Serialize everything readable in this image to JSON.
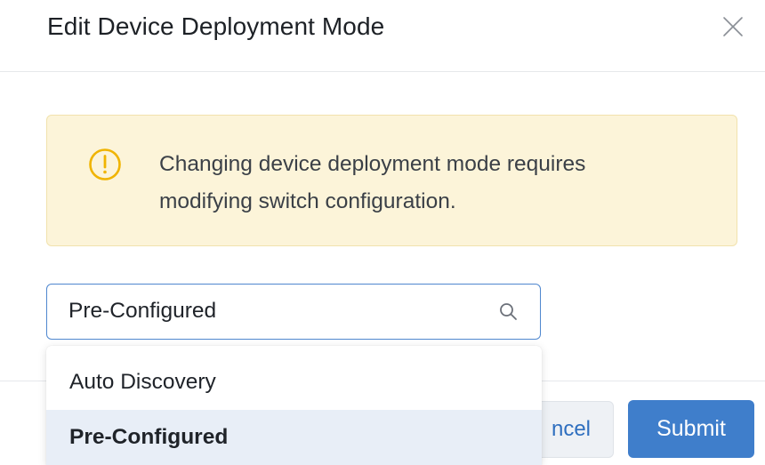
{
  "dialog": {
    "title": "Edit Device Deployment Mode",
    "close_icon": "close-icon"
  },
  "alert": {
    "icon": "warning-circle-icon",
    "line1": "Changing device deployment mode requires",
    "line2": "modifying switch configuration."
  },
  "select": {
    "value": "Pre-Configured",
    "search_icon": "search-icon",
    "options": [
      {
        "label": "Auto Discovery",
        "selected": false
      },
      {
        "label": "Pre-Configured",
        "selected": true
      }
    ]
  },
  "footer": {
    "cancel_label": "ncel",
    "submit_label": "Submit"
  },
  "colors": {
    "alert_bg": "#fcf4d9",
    "warning_icon": "#f0b400",
    "accent": "#3f7ecb",
    "selected_option_bg": "#e8eef7"
  }
}
